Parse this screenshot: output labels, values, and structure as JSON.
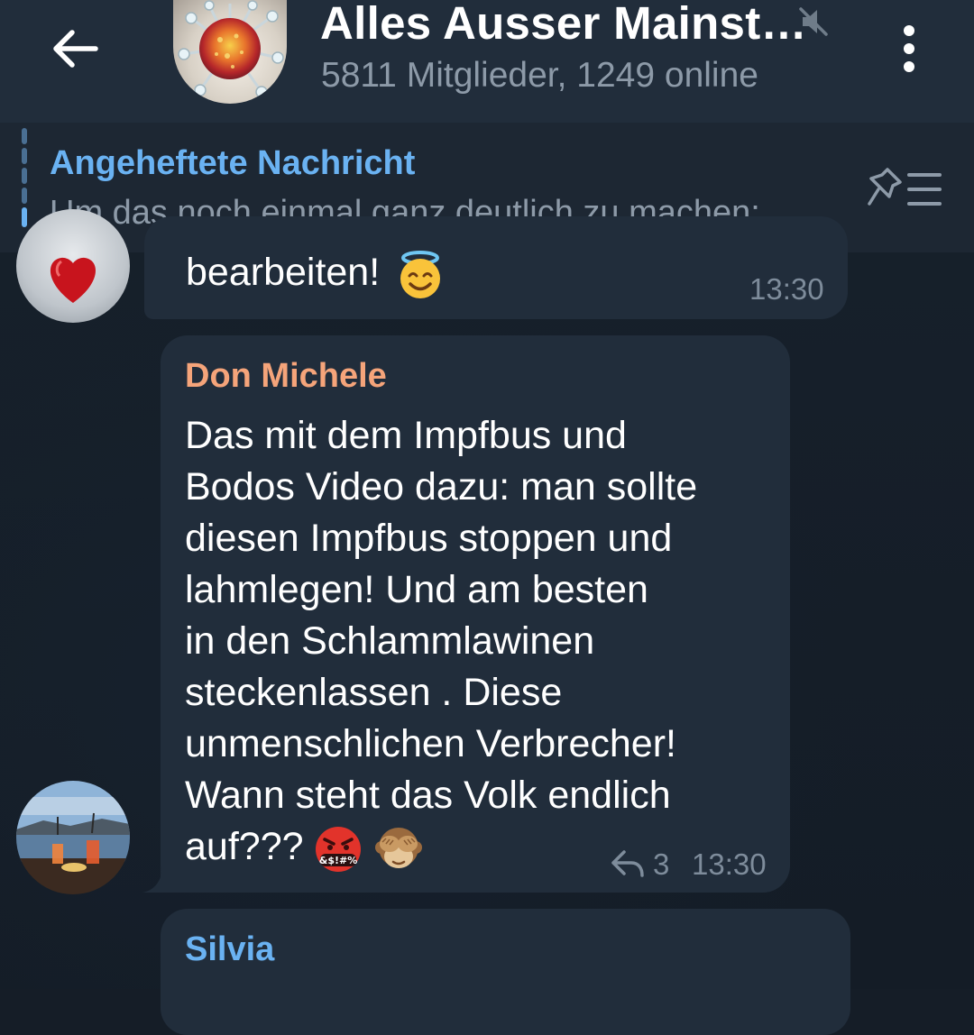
{
  "header": {
    "title": "Alles Ausser Mainst…",
    "subtitle": "5811 Mitglieder, 1249 online"
  },
  "pinned": {
    "title": "Angeheftete Nachricht",
    "text": "Um das noch einmal ganz deutlich zu machen:…"
  },
  "messages": [
    {
      "text": "bearbeiten!",
      "emoji": "smiling-face-with-halo",
      "time": "13:30"
    },
    {
      "sender": "Don Michele",
      "sender_color": "#f5a47a",
      "lines": [
        "Das mit dem Impfbus und",
        "Bodos Video dazu: man sollte",
        "diesen Impfbus stoppen und",
        "lahmlegen! Und am besten",
        "in den Schlammlawinen",
        "steckenlassen . Diese",
        "unmenschlichen Verbrecher!",
        "Wann steht das Volk endlich",
        "auf???"
      ],
      "emojis": [
        "face-with-symbols-on-mouth",
        "see-no-evil-monkey"
      ],
      "reply_count": "3",
      "time": "13:30"
    },
    {
      "sender": "Silvia",
      "sender_color": "#6ab2f2"
    }
  ],
  "colors": {
    "header_bg": "#212d3b",
    "chat_bg": "#151d27",
    "bubble_bg": "#212d3b",
    "accent": "#6ab2f2"
  }
}
